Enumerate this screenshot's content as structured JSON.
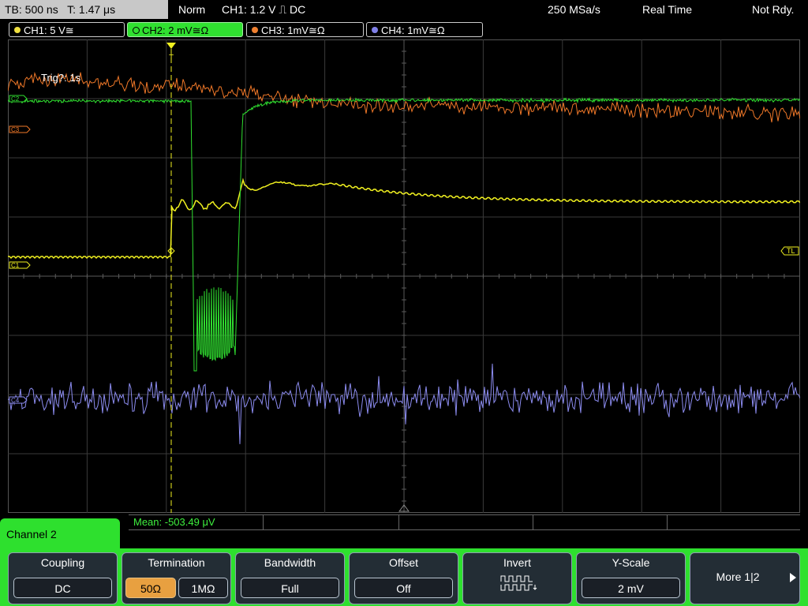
{
  "status": {
    "timebase": "TB: 500 ns",
    "trigger_time": "T: 1.47 μs",
    "mode": "Norm",
    "trigger": "CH1: 1.2 V ⎍ DC",
    "sample_rate": "250 MSa/s",
    "acq_mode": "Real Time",
    "state": "Not Rdy."
  },
  "channels": [
    {
      "label": "CH1: 5 V≅",
      "color": "#f0e040",
      "active": false
    },
    {
      "label": "CH2: 2 mV≅Ω",
      "color": "#30e030",
      "active": true
    },
    {
      "label": "CH3: 1mV≅Ω",
      "color": "#f08030",
      "active": false
    },
    {
      "label": "CH4: 1mV≅Ω",
      "color": "#8080e8",
      "active": false
    }
  ],
  "screen": {
    "trig_text": "Trig?: 1s",
    "markers": {
      "ch2": "C2",
      "ch3": "C3",
      "ch1": "C1",
      "trigger_level": "TL",
      "ch4": "C4",
      "trigger_position": "T"
    },
    "colors": {
      "ch1": "#f0f020",
      "ch2": "#30e030",
      "ch3": "#f07828",
      "ch4": "#8c8cf0",
      "grid": "#3a3a3a"
    }
  },
  "measurement": {
    "mean": "Mean: -503.49 μV"
  },
  "menu": {
    "channel_label": "Channel 2",
    "coupling": {
      "title": "Coupling",
      "value": "DC"
    },
    "termination": {
      "title": "Termination",
      "options": [
        "50Ω",
        "1MΩ"
      ],
      "selected": "50Ω"
    },
    "bandwidth": {
      "title": "Bandwidth",
      "value": "Full"
    },
    "offset": {
      "title": "Offset",
      "value": "Off"
    },
    "invert": {
      "title": "Invert",
      "icon": "invert-waveform-icon"
    },
    "yscale": {
      "title": "Y-Scale",
      "value": "2 mV"
    },
    "more": {
      "title": "More 1|2"
    }
  }
}
